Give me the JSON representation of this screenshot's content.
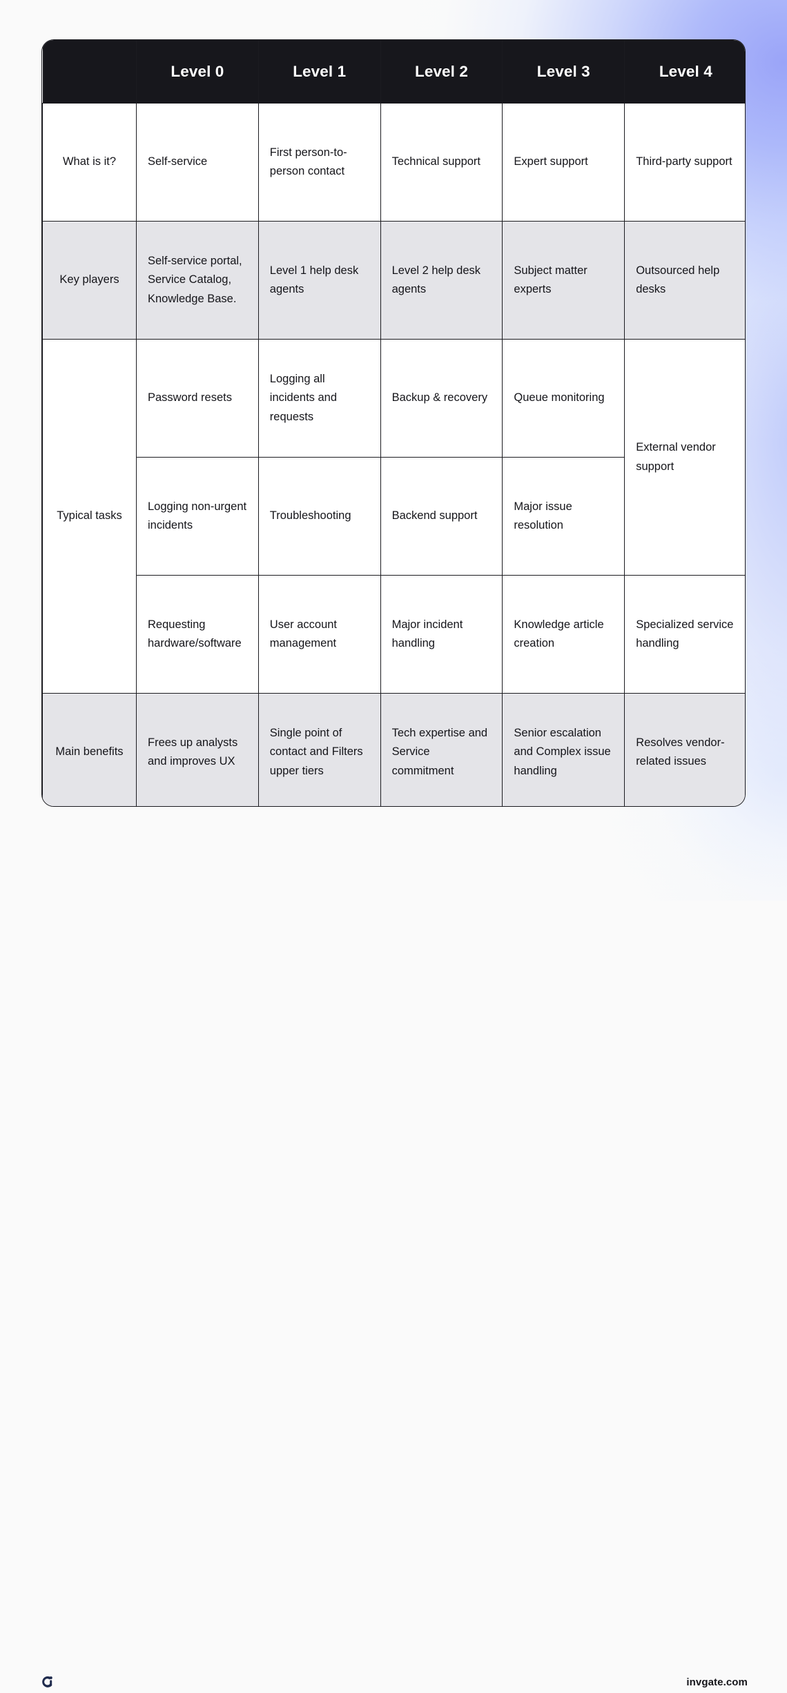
{
  "header": {
    "corner_label": "",
    "columns": [
      {
        "label": "Level 0"
      },
      {
        "label": "Level 1"
      },
      {
        "label": "Level 2"
      },
      {
        "label": "Level 3"
      },
      {
        "label": "Level 4"
      }
    ]
  },
  "rows": [
    {
      "label": "What is it?",
      "shaded": false,
      "cells": [
        "Self-service",
        "First person-to-person contact",
        "Technical support",
        "Expert support",
        "Third-party support"
      ]
    },
    {
      "label": "Key players",
      "shaded": true,
      "cells": [
        "Self-service portal, Service Catalog, Knowledge Base.",
        "Level 1 help desk agents",
        "Level 2 help desk agents",
        "Subject matter experts",
        "Outsourced help desks"
      ]
    },
    {
      "label": "Typical tasks",
      "shaded": false,
      "subrows": [
        {
          "cells": [
            "Password resets",
            "Logging all incidents and requests",
            "Backup & recovery",
            "Queue monitoring"
          ],
          "level4": "External vendor support"
        },
        {
          "cells": [
            "Logging non-urgent incidents",
            "Troubleshooting",
            "Backend support",
            "Major issue resolution"
          ],
          "level4": "Specialized service handling"
        },
        {
          "cells": [
            "Requesting hardware/software",
            "User account management",
            "Major incident handling",
            "Knowledge article creation"
          ]
        }
      ]
    },
    {
      "label": "Main benefits",
      "shaded": true,
      "cells": [
        "Frees up analysts and improves UX",
        "Single point of contact and Filters upper tiers",
        "Tech expertise and Service commitment",
        "Senior escalation and Complex issue handling",
        "Resolves vendor-related issues"
      ]
    }
  ],
  "footer": {
    "logo_name": "invgate-logo-icon",
    "domain": "invgate.com"
  },
  "colors": {
    "header_bg": "#17171c",
    "header_text": "#ffffff",
    "shaded_row_bg": "#e4e4e8",
    "plain_row_bg": "#ffffff",
    "border": "#1b1b20",
    "page_bg": "#fafafa",
    "gradient_accent": "#96a0f8",
    "logo_navy": "#1f2b4d"
  }
}
